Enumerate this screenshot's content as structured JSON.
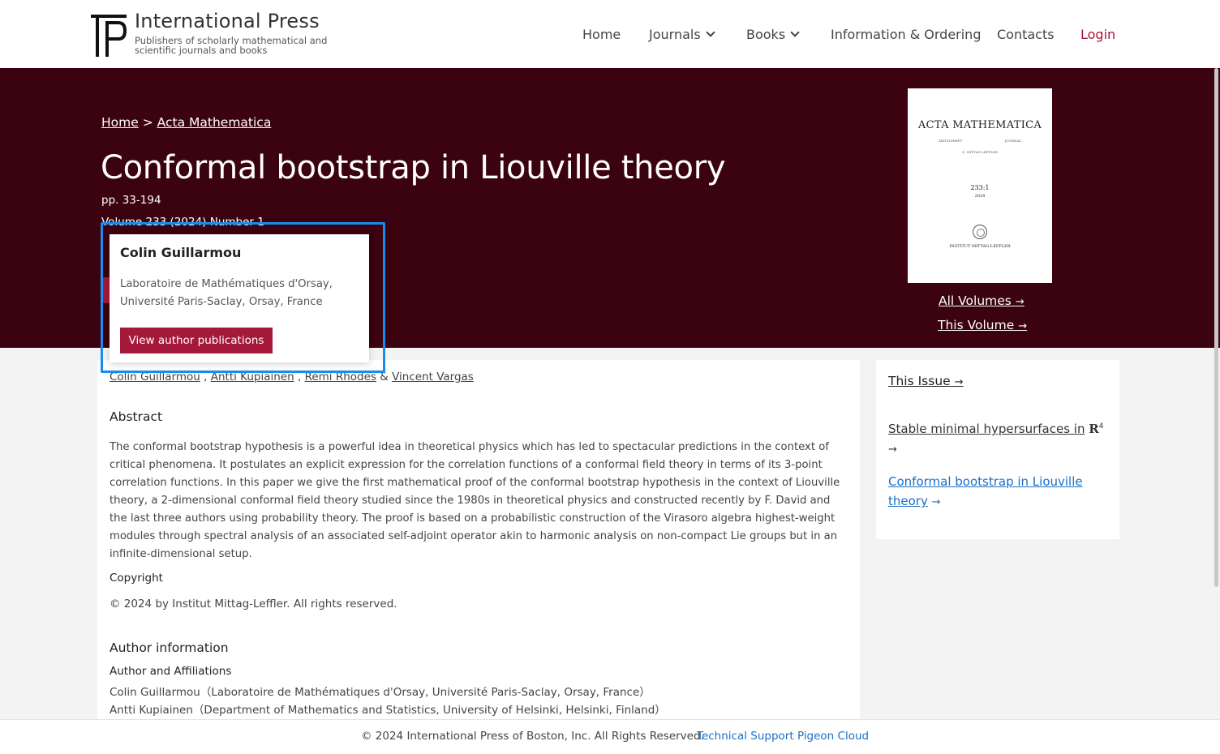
{
  "header": {
    "brand": "International Press",
    "tagline": "Publishers of scholarly mathematical and scientific journals and books",
    "nav": {
      "home": "Home",
      "journals": "Journals",
      "books": "Books",
      "info": "Information & Ordering",
      "contacts": "Contacts",
      "login": "Login"
    }
  },
  "hero": {
    "breadcrumb": {
      "home": "Home",
      "sep": ">",
      "journal": "Acta Mathematica"
    },
    "title": "Conformal bootstrap in Liouville theory",
    "pages": "pp. 33-194",
    "volume": "Volume 233 (2024) Number 1",
    "cover": {
      "title": "ACTA MATHEMATICA",
      "left_sub": "ZEITSCHRIFT",
      "right_sub": "JOURNAL",
      "editor": "G. MITTAG-LEFFLER",
      "volume": "233:1",
      "year": "2024",
      "institute": "INSTITUT MITTAG-LEFFLER"
    },
    "all_volumes": "All Volumes",
    "this_volume": "This Volume"
  },
  "popup": {
    "name": "Colin Guillarmou",
    "affiliation": "Laboratoire de Mathématiques d'Orsay, Université Paris-Saclay, Orsay, France",
    "button": "View author publications"
  },
  "authors": {
    "a1": "Colin Guillarmou",
    "a2": "Antti Kupiainen",
    "a3": "Rémi Rhodes",
    "a4": "Vincent Vargas",
    "comma": ",",
    "amp": "&"
  },
  "abstract": {
    "heading": "Abstract",
    "text": "The conformal bootstrap hypothesis is a powerful idea in theoretical physics which has led to spectacular predictions in the context of critical phenomena. It postulates an explicit expression for the correlation functions of a conformal field theory in terms of its 3-point correlation functions. In this paper we give the first mathematical proof of the conformal bootstrap hypothesis in the context of Liouville theory, a 2-dimensional conformal field theory studied since the 1980s in theoretical physics and constructed recently by F. David and the last three authors using probability theory. The proof is based on a probabilistic construction of the Virasoro algebra highest-weight modules through spectral analysis of an associated self-adjoint operator akin to harmonic analysis on non-compact Lie groups but in an infinite-dimensional setup."
  },
  "copyright": {
    "heading": "Copyright",
    "text": "© 2024 by Institut Mittag-Leffler. All rights reserved."
  },
  "author_info": {
    "heading": "Author information",
    "subheading": "Author and Affiliations",
    "rows": [
      "Colin Guillarmou（Laboratoire de Mathématiques d'Orsay, Université Paris-Saclay, Orsay, France）",
      "Antti Kupiainen（Department of Mathematics and Statistics, University of Helsinki, Helsinki, Finland）"
    ]
  },
  "sidebar": {
    "heading": "This Issue",
    "item1": "Stable minimal hypersurfaces in",
    "item1_math": "R",
    "item1_sup": "4",
    "item2": "Conformal bootstrap in Liouville theory",
    "arrow": "→"
  },
  "footer": {
    "copyright": "© 2024 International Press of Boston, Inc. All Rights Reserved.",
    "support": "Technical Support Pigeon Cloud"
  },
  "colors": {
    "hero_bg": "#3b020f",
    "accent": "#a5183a",
    "link_blue": "#1a6fc7",
    "highlight": "#1a8cf0"
  }
}
